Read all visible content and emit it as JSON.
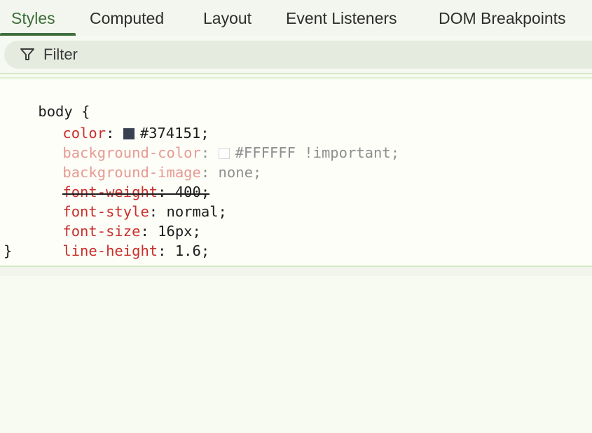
{
  "tabs": [
    {
      "label": "Styles",
      "active": true
    },
    {
      "label": "Computed"
    },
    {
      "label": "Layout"
    },
    {
      "label": "Event Listeners"
    },
    {
      "label": "DOM Breakpoints"
    }
  ],
  "filter": {
    "placeholder": "Filter",
    "icon": "filter-icon"
  },
  "rule": {
    "selector": "body",
    "open_brace": "{",
    "close_brace": "}",
    "declarations": [
      {
        "property": "color",
        "value": "#374151",
        "suffix": ";",
        "swatch": "#374151"
      },
      {
        "property": "background-color",
        "value": "#FFFFFF !important",
        "suffix": ";",
        "swatch": "#FFFFFF",
        "inactive": true
      },
      {
        "property": "background-image",
        "value": "none",
        "suffix": ";",
        "inactive": true
      },
      {
        "property": "font-weight",
        "value": "400",
        "suffix": ";",
        "overridden": true
      },
      {
        "property": "font-style",
        "value": "normal",
        "suffix": ";"
      },
      {
        "property": "font-size",
        "value": "16px",
        "suffix": ";"
      },
      {
        "property": "line-height",
        "value": "1.6",
        "suffix": ";"
      }
    ]
  },
  "colors": {
    "accent": "#3f6f3e",
    "property": "#c9302c",
    "background": "#f7fbf2"
  }
}
